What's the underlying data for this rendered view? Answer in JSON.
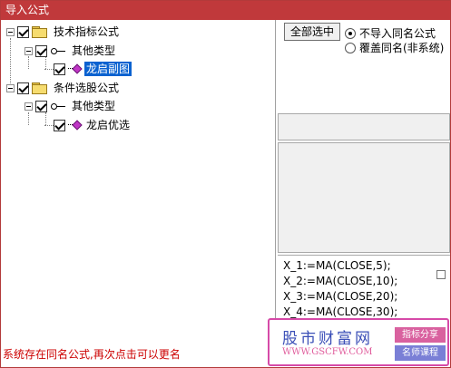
{
  "window": {
    "title": "导入公式"
  },
  "tree": {
    "nodes": [
      {
        "label": "技术指标公式",
        "checked": true
      },
      {
        "label": "其他类型",
        "checked": true
      },
      {
        "label": "龙启副图",
        "checked": true,
        "selected": true
      },
      {
        "label": "条件选股公式",
        "checked": true
      },
      {
        "label": "其他类型",
        "checked": true
      },
      {
        "label": "龙启优选",
        "checked": true
      }
    ]
  },
  "actions": {
    "select_all_label": "全部选中"
  },
  "options": {
    "no_import_label": "不导入同名公式",
    "overwrite_label": "覆盖同名(非系统)",
    "selected": "no_import"
  },
  "formula_lines": [
    "X_1:=MA(CLOSE,5);",
    "X_2:=MA(CLOSE,10);",
    "X_3:=MA(CLOSE,20);",
    "X_4:=MA(CLOSE,30);"
  ],
  "status": {
    "message": "系统存在同名公式,再次点击可以更名"
  },
  "watermark": {
    "title": "股市财富网",
    "url": "WWW.GSCFW.COM",
    "tag1": "指标分享",
    "tag2": "名师课程",
    "colors": {
      "border": "#d64aa8",
      "title": "#3b4fb7",
      "tag1": "#d9619f",
      "tag2": "#7a7fd6"
    }
  },
  "colors": {
    "titlebar": "#c0393b",
    "selection": "#0a62d0",
    "status_text": "#cc0000"
  }
}
